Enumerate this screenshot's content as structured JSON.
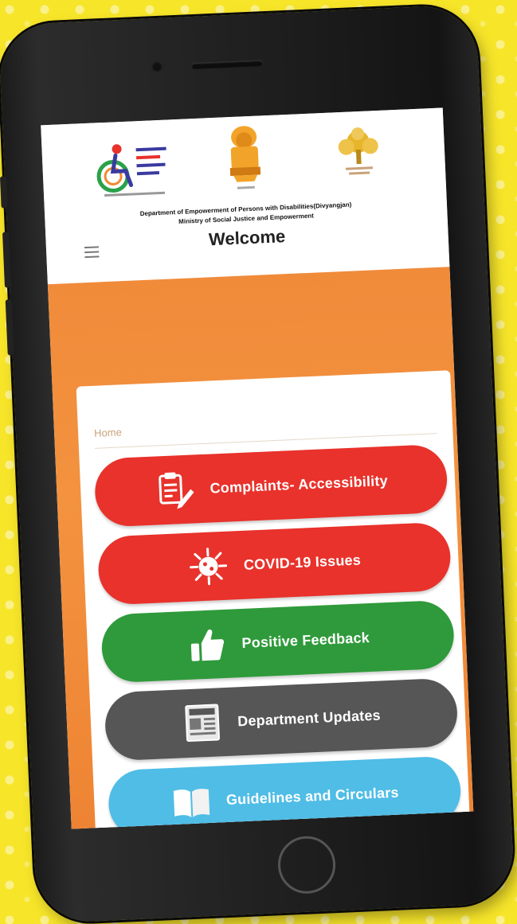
{
  "header": {
    "department_line": "Department of Empowerment of Persons with Disabilities(Divyangjan)",
    "ministry_line": "Ministry of Social Justice and Empowerment",
    "welcome": "Welcome"
  },
  "breadcrumb": "Home",
  "menu": [
    {
      "label": "Complaints- Accessibility",
      "icon": "clipboard-pen-icon",
      "color": "#e8322b"
    },
    {
      "label": "COVID-19 Issues",
      "icon": "virus-icon",
      "color": "#e8322b"
    },
    {
      "label": "Positive Feedback",
      "icon": "thumbs-up-icon",
      "color": "#2f9a3b"
    },
    {
      "label": "Department Updates",
      "icon": "newspaper-icon",
      "color": "#565656"
    },
    {
      "label": "Guidelines and Circulars",
      "icon": "open-book-icon",
      "color": "#4fbde6"
    }
  ],
  "colors": {
    "background": "#f7e52a",
    "header_band": "#f08b3a",
    "phone_frame": "#1b1b1b"
  }
}
